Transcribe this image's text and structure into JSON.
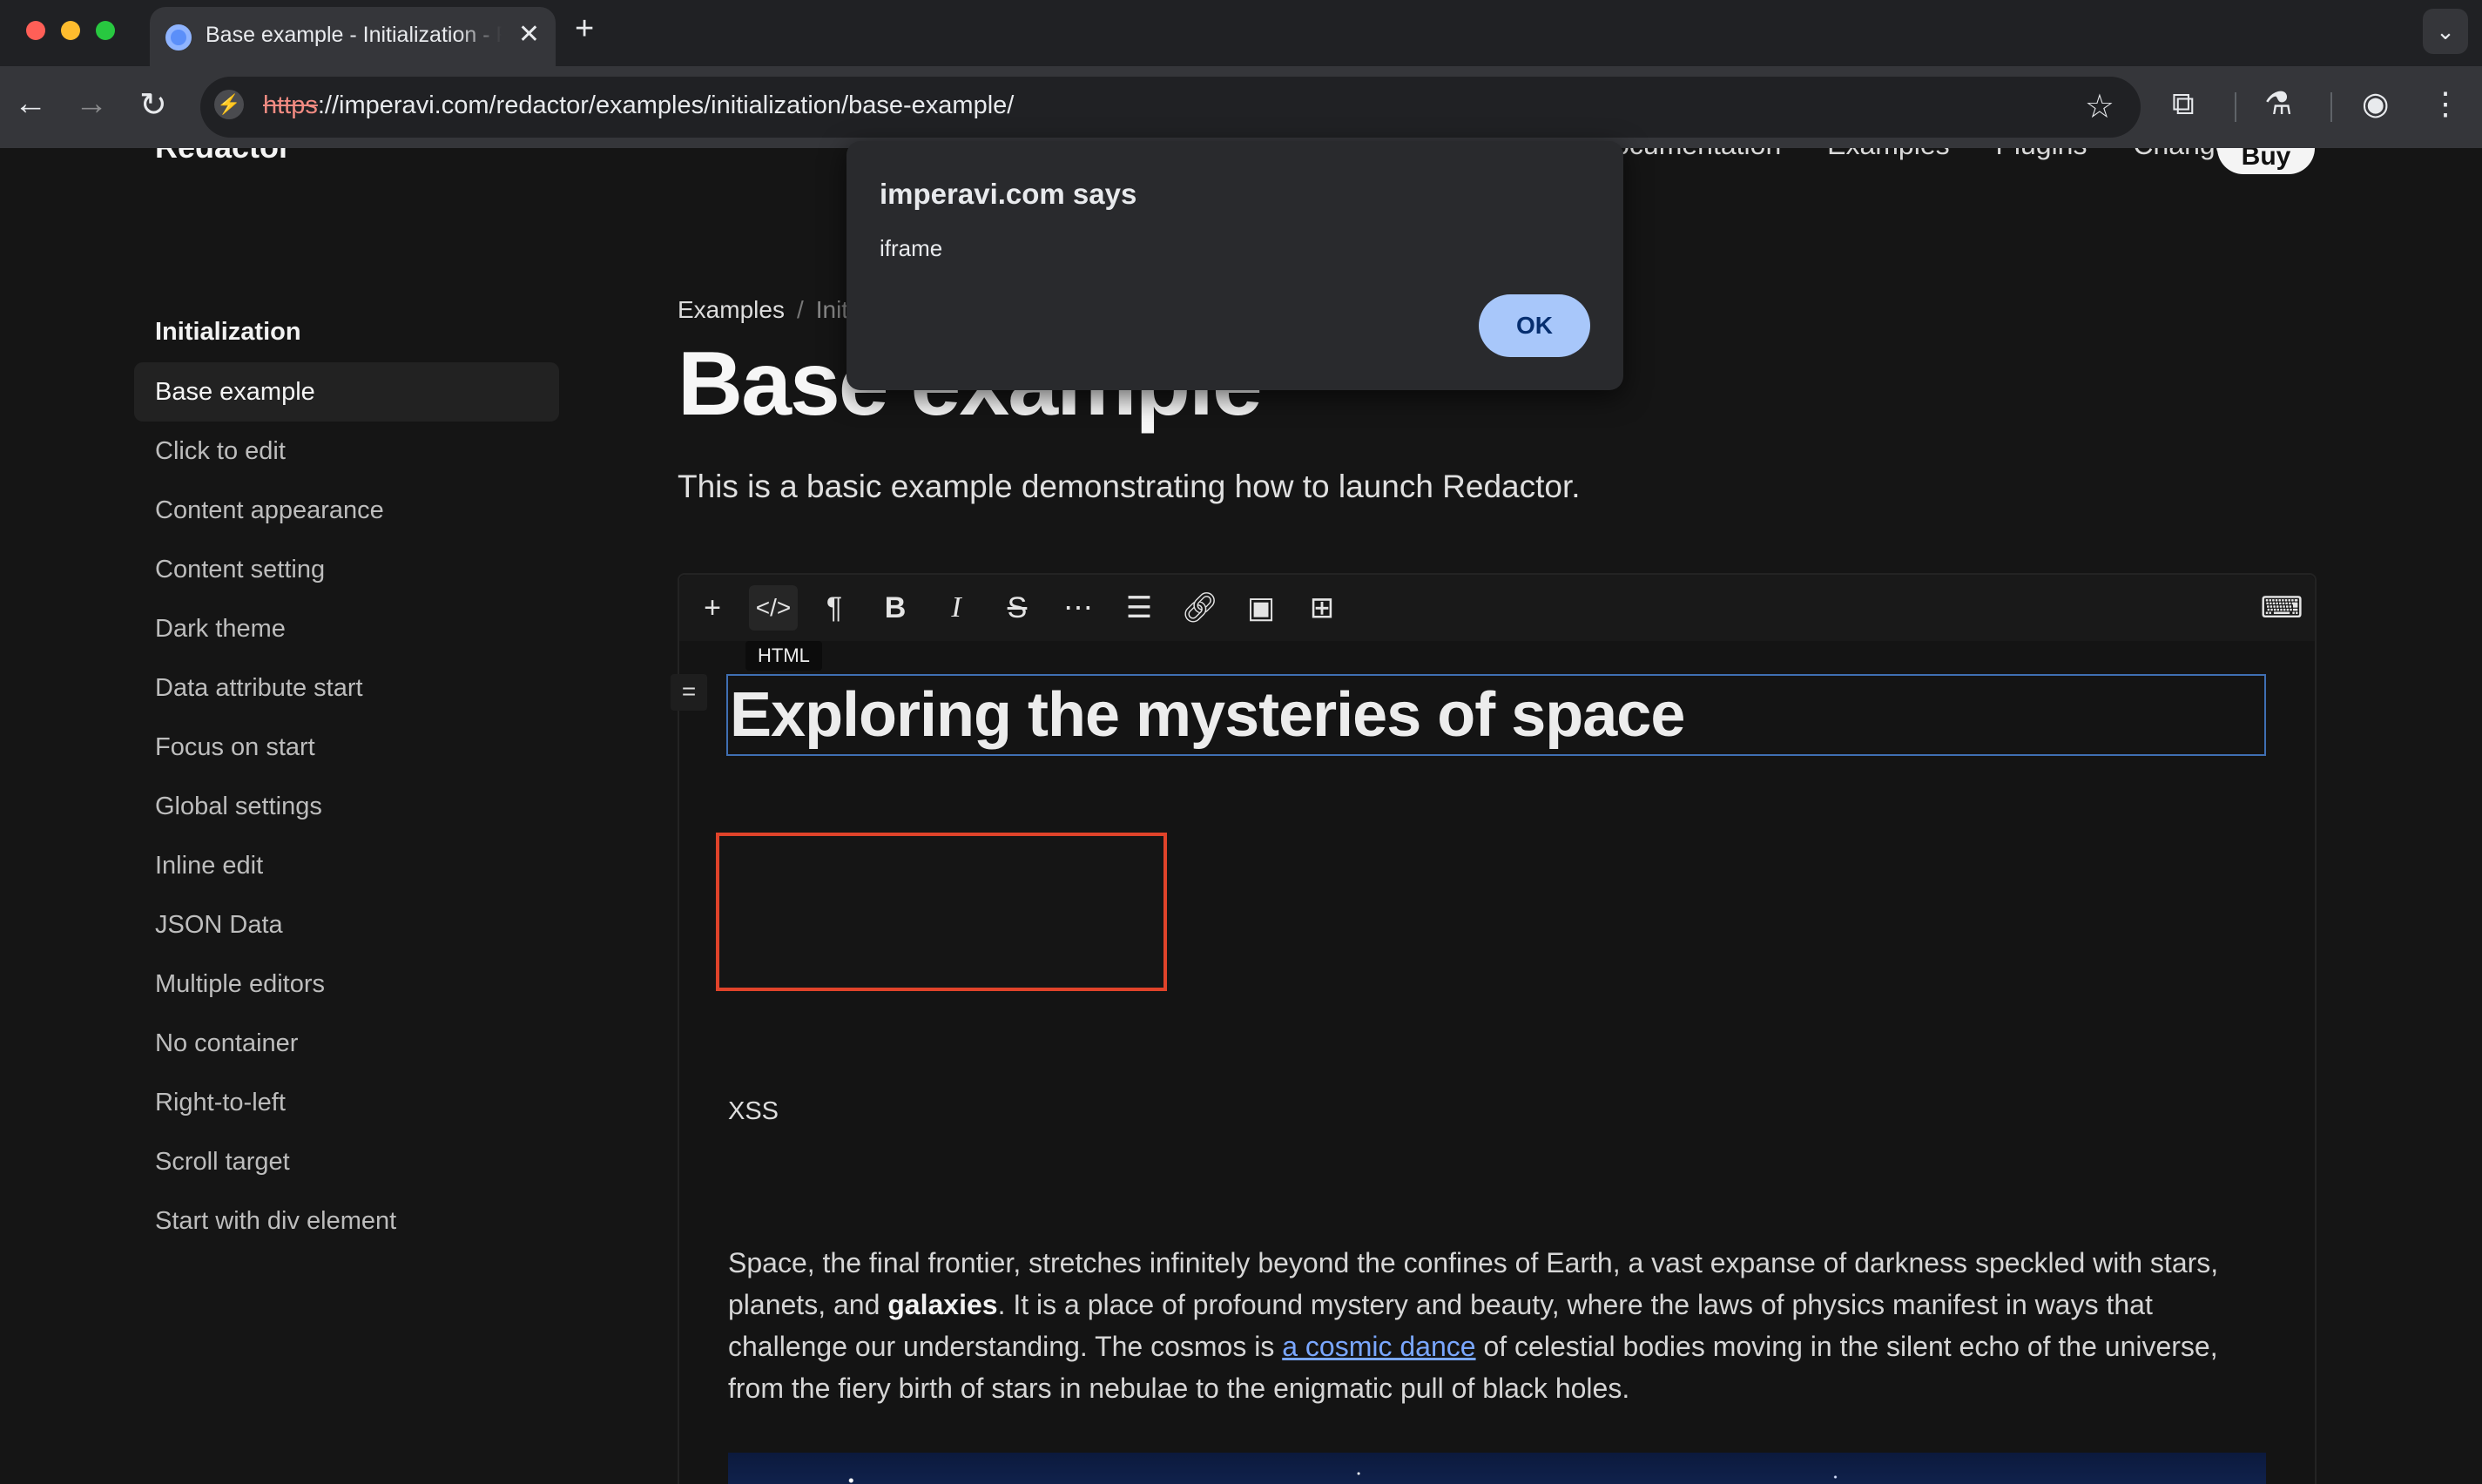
{
  "browser": {
    "tab_title": "Base example - Initialization - Redactor",
    "tab_close": "✕",
    "new_tab": "+",
    "tab_menu": "⌄",
    "url_scheme": "https",
    "url_rest": "://imperavi.com/redactor/examples/initialization/base-example/"
  },
  "site": {
    "brand": "Redactor",
    "nav_links": [
      "Documentation",
      "Examples",
      "Plugins",
      "Changelog"
    ],
    "buy_label": "Buy"
  },
  "sidebar": {
    "heading": "Initialization",
    "items": [
      {
        "label": "Base example",
        "active": true
      },
      {
        "label": "Click to edit"
      },
      {
        "label": "Content appearance"
      },
      {
        "label": "Content setting"
      },
      {
        "label": "Dark theme"
      },
      {
        "label": "Data attribute start"
      },
      {
        "label": "Focus on start"
      },
      {
        "label": "Global settings"
      },
      {
        "label": "Inline edit"
      },
      {
        "label": "JSON Data"
      },
      {
        "label": "Multiple editors"
      },
      {
        "label": "No container"
      },
      {
        "label": "Right-to-left"
      },
      {
        "label": "Scroll target"
      },
      {
        "label": "Start with div element"
      }
    ]
  },
  "main": {
    "breadcrumb": {
      "first": "Examples",
      "separator": "/",
      "current": "Initialization"
    },
    "title": "Base example",
    "description": "This is a basic example demonstrating how to launch Redactor."
  },
  "editor": {
    "tooltip": "HTML",
    "toolbar_icons": [
      "add-icon",
      "html-icon",
      "format-icon",
      "bold-icon",
      "italic-icon",
      "strike-icon",
      "more-icon",
      "list-icon",
      "link-icon",
      "image-icon",
      "table-icon",
      "shortcuts-icon"
    ],
    "drag_handle": "=",
    "heading": "Exploring the mysteries of space",
    "xss_text": "XSS",
    "paragraph": {
      "part1": "Space, the final frontier, stretches infinitely beyond the confines of Earth, a vast expanse of darkness speckled with stars, planets, and ",
      "bold": "galaxies",
      "part2": ". It is a place of profound mystery and beauty, where the laws of physics manifest in ways that challenge our understanding. The cosmos is ",
      "link": "a cosmic dance",
      "part3": " of celestial bodies moving in the silent echo of the universe, from the fiery birth of stars in nebulae to the enigmatic pull of black holes."
    }
  },
  "dialog": {
    "title": "imperavi.com says",
    "message": "iframe",
    "ok_label": "OK"
  },
  "colors": {
    "accent_ok": "#a8c7fa",
    "iframe_border": "#e0432a",
    "link": "#7aa7ff"
  }
}
